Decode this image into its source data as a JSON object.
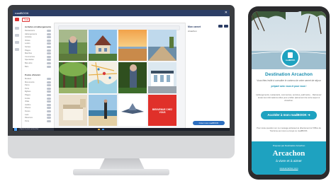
{
  "desktop_app": {
    "window_title": "roadBOOK",
    "toolbar_label": "Tous",
    "search_placeholder": "",
    "filters_section_1": "Activités & Hébergements",
    "filters_section_2": "Points d'intérêt",
    "filters_group_1": [
      "Restaurants",
      "Hébergements",
      "Activités",
      "Visites",
      "Loisirs",
      "Sorties",
      "Plages",
      "Marchés",
      "Commerces",
      "Spectacles",
      "Bien-être",
      "Bars"
    ],
    "filters_group_2": [
      "Musées",
      "Monuments",
      "Parcs",
      "Ports",
      "Églises",
      "Plages",
      "Forêts",
      "Villas",
      "Jardins",
      "Phares",
      "Dunes",
      "Lacs",
      "Réserves",
      "Ports"
    ],
    "right_panel_title": "Mon carnet",
    "right_panel_subtitle": "Arcachon",
    "right_panel_button": "Créer mon roadBOOK",
    "taskbar_search": "Taper ici pour rechercher",
    "tiles": [
      "photo-1",
      "photo-2",
      "photo-3",
      "photo-4",
      "photo-5",
      "photo-6",
      "photo-7",
      "photo-8",
      "photo-9",
      "photo-10",
      "photo-11",
      "photo-12"
    ],
    "red_tile_text": "BIENVENUE CHEZ VOUS"
  },
  "phone_app": {
    "badge_text": "roadBOOK",
    "title": "Destination Arcachon",
    "intro_line_1": "Vous êtes invité à consulter le contenu de votre carnet de séjour",
    "intro_line_2": "préparé avec vous et pour vous !",
    "body": "Hébergements, restaurants, commerces, services, patrimoine... Retrouvez toutes les informations utiles pour profiter pleinement de votre séjour à Arcachon.",
    "cta": "Accéder à mon roadBOOK ➜",
    "note": "Pour toute question sur ce message adressez-le directement à l'Office de Tourisme qui vous a envoyé ce roadBOOK.",
    "footer_caption": "Proposé par Destination Arcachon",
    "footer_brand": "Arcachon",
    "footer_tagline": "à vivre et à aimer",
    "footer_link": "www.arcachon.com",
    "colors": {
      "accent": "#1ea2c0",
      "title": "#1c8fb0",
      "app_bar": "#2c3e66",
      "red_tile": "#e0302a"
    }
  }
}
